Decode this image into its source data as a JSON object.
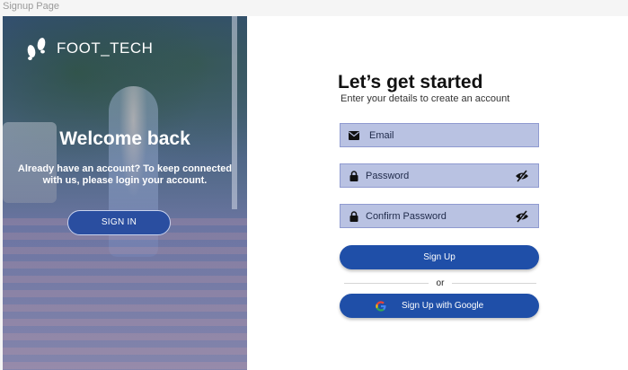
{
  "frame": {
    "label": "Signup Page"
  },
  "brand": {
    "name": "FOOT_TECH",
    "logo_icon": "footprints-icon"
  },
  "hero": {
    "heading": "Welcome back",
    "subtext": "Already have an account? To keep connected with us, please login your account.",
    "signin_label": "SIGN IN"
  },
  "form": {
    "title": "Let’s get started",
    "subtitle": "Enter your details to create an account",
    "email": {
      "placeholder": "Email",
      "icon": "envelope-icon"
    },
    "password": {
      "placeholder": "Password",
      "icon": "lock-icon",
      "toggle_icon": "eye-slash-icon"
    },
    "confirm_password": {
      "placeholder": "Confirm Password",
      "icon": "lock-icon",
      "toggle_icon": "eye-slash-icon"
    },
    "signup_label": "Sign Up",
    "divider_text": "or",
    "google_label": "Sign Up with Google"
  },
  "colors": {
    "primary_button": "#1f4fa8",
    "input_fill": "#b9c2e2",
    "hero_overlay": "#2a4ea0"
  }
}
